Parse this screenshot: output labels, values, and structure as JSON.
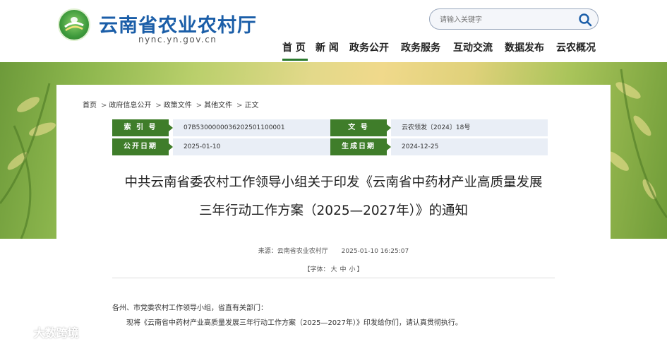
{
  "header": {
    "site_name": "云南省农业农村厅",
    "site_url": "nync.yn.gov.cn",
    "search_placeholder": "请输入关键字"
  },
  "nav": {
    "items": [
      "首 页",
      "新 闻",
      "政务公开",
      "政务服务",
      "互动交流",
      "数据发布",
      "云农概况"
    ],
    "active_index": 0
  },
  "breadcrumb": [
    "首页",
    "政府信息公开",
    "政策文件",
    "其他文件",
    "正文"
  ],
  "meta": {
    "index_label": "索 引 号",
    "index_value": "07B5300000036202501100001",
    "doc_label": "文 号",
    "doc_value": "云农领发〔2024〕18号",
    "publish_label": "公开日期",
    "publish_value": "2025-01-10",
    "created_label": "生成日期",
    "created_value": "2024-12-25"
  },
  "article": {
    "title_line1": "中共云南省委农村工作领导小组关于印发《云南省中药材产业高质量发展",
    "title_line2": "三年行动工作方案（2025—2027年）》的通知",
    "source": "来源：云南省农业农村厅",
    "datetime": "2025-01-10 16:25:07",
    "font_label_prefix": "【字体：",
    "font_sizes": [
      "大",
      "中",
      "小"
    ],
    "font_label_suffix": "】",
    "paragraph1": "各州、市党委农村工作领导小组，省直有关部门：",
    "paragraph2": "现将《云南省中药材产业高质量发展三年行动工作方案（2025—2027年）》印发给你们，请认真贯彻执行。"
  },
  "watermark": {
    "text": "大数跨境"
  },
  "colors": {
    "brand_blue": "#1b5ea8",
    "label_green": "#3f7d2a",
    "value_bg": "#e9eef6"
  }
}
